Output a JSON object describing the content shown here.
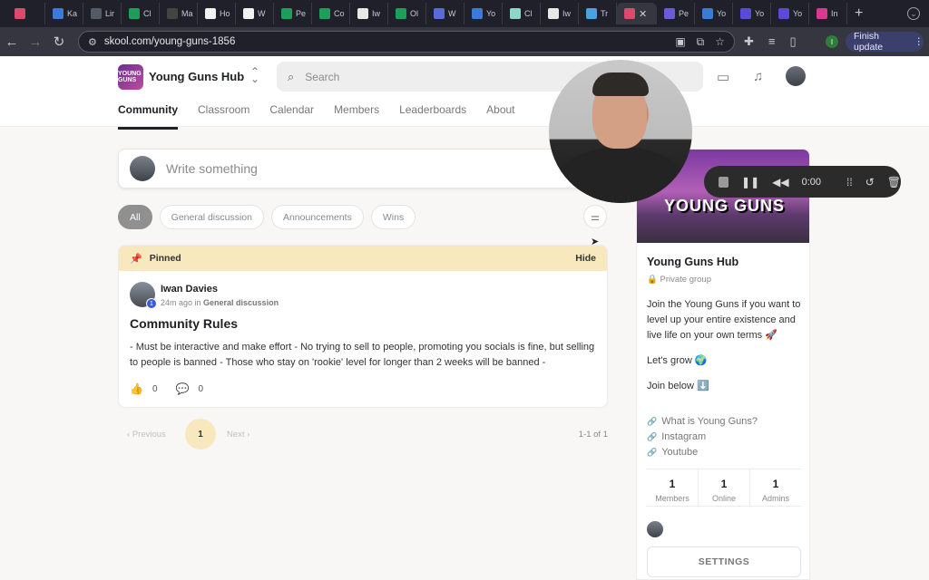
{
  "browser": {
    "tabs": [
      {
        "label": "",
        "color": "#d94b6b"
      },
      {
        "label": "Ka",
        "color": "#3b7bd6"
      },
      {
        "label": "Lir",
        "color": "#555a66"
      },
      {
        "label": "Cl",
        "color": "#1e9e5a"
      },
      {
        "label": "Ma",
        "color": "#444"
      },
      {
        "label": "Ho",
        "color": "#f2f2f2"
      },
      {
        "label": "W",
        "color": "#f2f2f2"
      },
      {
        "label": "Pe",
        "color": "#1e9e5a"
      },
      {
        "label": "Co",
        "color": "#1e9e5a"
      },
      {
        "label": "Iw",
        "color": "#e8e8e8"
      },
      {
        "label": "Ol",
        "color": "#1e9e5a"
      },
      {
        "label": "W",
        "color": "#5b6bd6"
      },
      {
        "label": "Yo",
        "color": "#3b7bd6"
      },
      {
        "label": "Cl",
        "color": "#8fd6c9"
      },
      {
        "label": "Iw",
        "color": "#e8e8e8"
      },
      {
        "label": "Tr",
        "color": "#4aa3e0"
      }
    ],
    "active_tab_label": "",
    "tabs_after": [
      {
        "label": "Pe",
        "color": "#6a5bd6"
      },
      {
        "label": "Yo",
        "color": "#3b7bd6"
      },
      {
        "label": "Yo",
        "color": "#5a4ad6"
      },
      {
        "label": "Yo",
        "color": "#5a4ad6"
      },
      {
        "label": "In",
        "color": "#d63b8f"
      }
    ],
    "url": "skool.com/young-guns-1856",
    "finish_update": "Finish update",
    "profile_initial": "I"
  },
  "header": {
    "logo_text": "YOUNG GUNS",
    "group_name": "Young Guns Hub",
    "search_placeholder": "Search",
    "nav": [
      "Community",
      "Classroom",
      "Calendar",
      "Members",
      "Leaderboards",
      "About"
    ]
  },
  "composer": {
    "placeholder": "Write something"
  },
  "filters": [
    "All",
    "General discussion",
    "Announcements",
    "Wins"
  ],
  "post": {
    "pinned_label": "Pinned",
    "hide_label": "Hide",
    "author": "Iwan Davies",
    "level": "1",
    "time": "24m ago in ",
    "category": "General discussion",
    "title": "Community Rules",
    "body": "- Must be interactive and make effort - No trying to sell to people, promoting you socials is fine, but selling to people is banned - Those who stay on 'rookie' level for longer than 2 weeks will be banned -",
    "likes": "0",
    "comments": "0"
  },
  "pagination": {
    "previous": "Previous",
    "current": "1",
    "next": "Next",
    "count": "1-1 of 1"
  },
  "side": {
    "cover_title": "YOUNG GUNS",
    "name": "Young Guns Hub",
    "privacy": "Private group",
    "description": "Join the Young Guns if you want to level up your entire existence and live life on your own terms 🚀",
    "grow": "Let's grow 🌍",
    "join": "Join below ⬇️",
    "links": [
      "What is Young Guns?",
      "Instagram",
      "Youtube"
    ],
    "stats": [
      {
        "value": "1",
        "label": "Members"
      },
      {
        "value": "1",
        "label": "Online"
      },
      {
        "value": "1",
        "label": "Admins"
      }
    ],
    "settings_label": "SETTINGS"
  },
  "recorder": {
    "time": "0:00"
  }
}
